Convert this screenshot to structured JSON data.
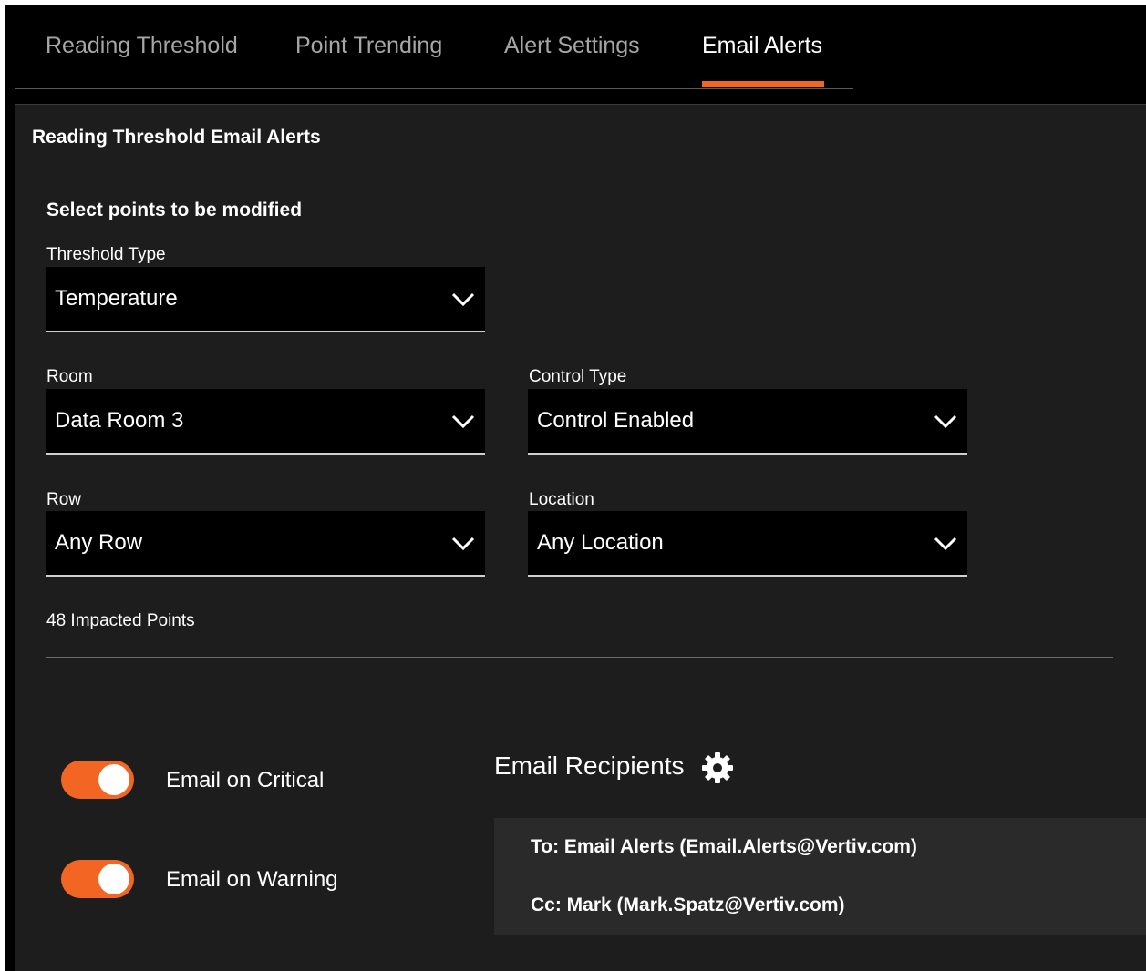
{
  "tabs": [
    {
      "label": "Reading Threshold",
      "active": false
    },
    {
      "label": "Point Trending",
      "active": false
    },
    {
      "label": "Alert Settings",
      "active": false
    },
    {
      "label": "Email Alerts",
      "active": true
    }
  ],
  "panel": {
    "title": "Reading Threshold Email Alerts",
    "section_title": "Select points to be modified"
  },
  "fields": {
    "threshold_type": {
      "label": "Threshold Type",
      "value": "Temperature"
    },
    "room": {
      "label": "Room",
      "value": "Data Room 3"
    },
    "control_type": {
      "label": "Control Type",
      "value": "Control Enabled"
    },
    "row": {
      "label": "Row",
      "value": "Any Row"
    },
    "location": {
      "label": "Location",
      "value": "Any Location"
    }
  },
  "impacted_points": "48 Impacted Points",
  "toggles": {
    "critical": {
      "label": "Email on Critical",
      "on": true
    },
    "warning": {
      "label": "Email on Warning",
      "on": true
    }
  },
  "recipients": {
    "title": "Email Recipients",
    "to": "To: Email Alerts (Email.Alerts@Vertiv.com)",
    "cc": "Cc: Mark (Mark.Spatz@Vertiv.com)"
  },
  "colors": {
    "accent": "#f26522",
    "background": "#000000",
    "panel": "#1d1d1d",
    "recipients_box": "#2a2a2a",
    "inactive_tab_text": "#a6a6a6"
  },
  "icons": [
    "chevron-down-icon",
    "gear-icon"
  ]
}
